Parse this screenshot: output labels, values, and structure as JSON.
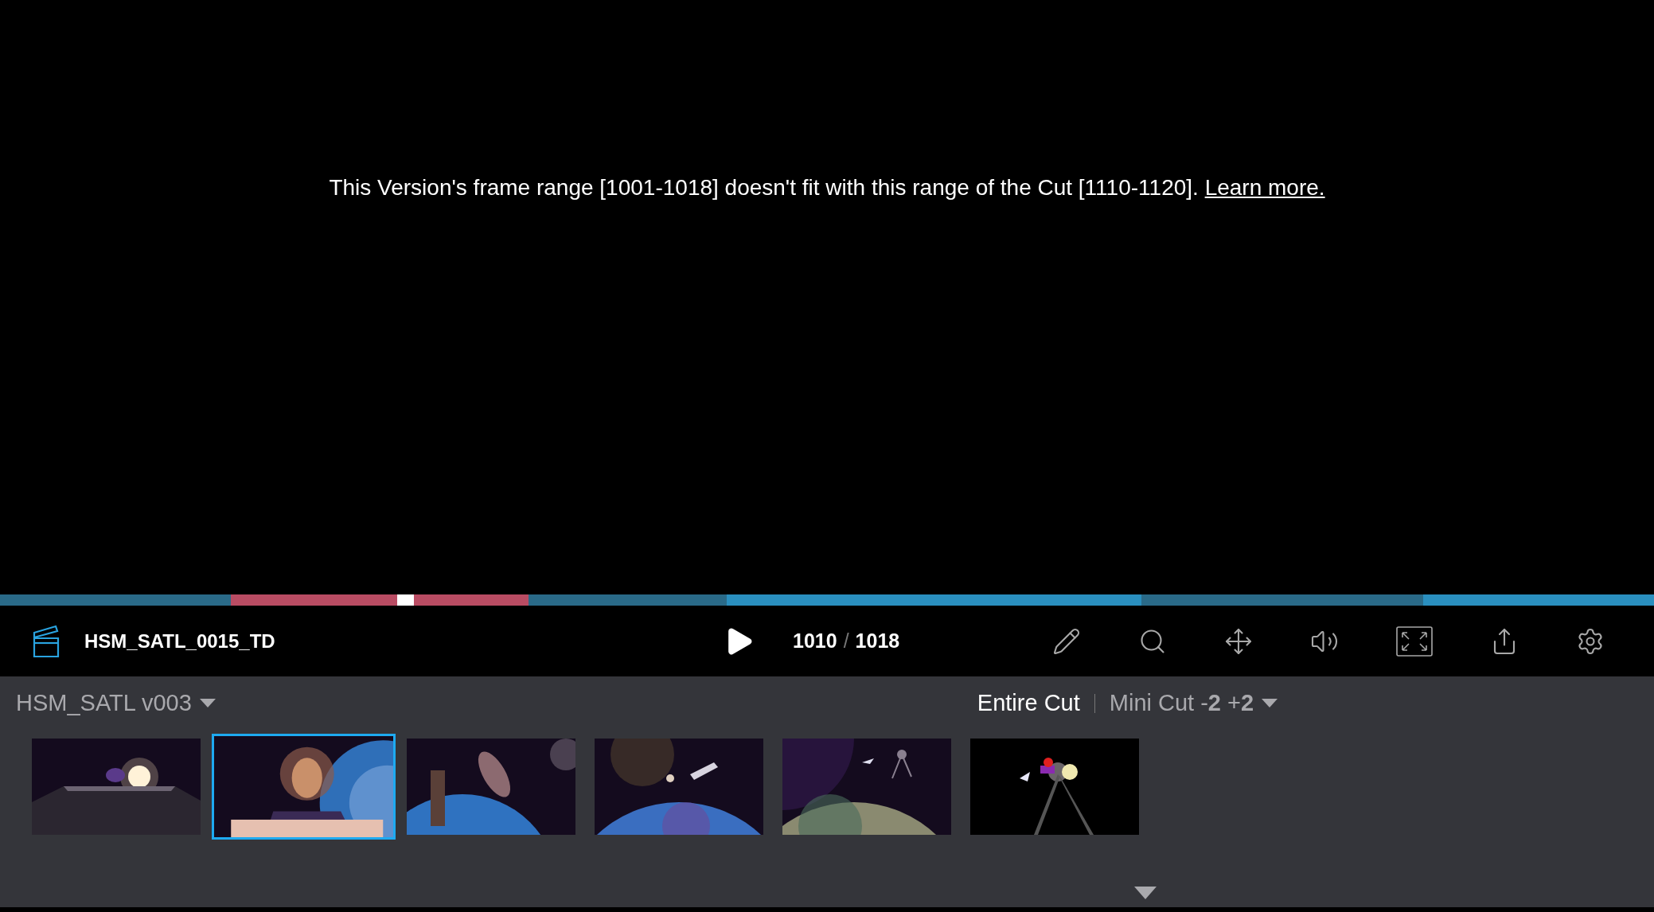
{
  "viewer": {
    "message": "This Version's frame range [1001-1018] doesn't fit with this range of the Cut [1110-1120].",
    "link": "Learn more."
  },
  "timeline": {
    "segments": [
      {
        "color": "#2a6a88"
      },
      {
        "color": "#b94c63"
      },
      {
        "color": "#b94c63"
      },
      {
        "color": "#2a6a88"
      },
      {
        "color": "#2a8fbf"
      },
      {
        "color": "#2a6a88"
      },
      {
        "color": "#2a8fbf"
      }
    ],
    "playhead": {
      "level": 0.24
    }
  },
  "toolbar": {
    "title": "HSM_SATL_0015_TD",
    "current_frame": "1010",
    "separator": "/",
    "total_frames": "1018"
  },
  "panel": {
    "version": "HSM_SATL v003",
    "views": [
      {
        "label": "Entire Cut",
        "selected": true
      },
      {
        "label": "Mini Cut -**2** +**2**",
        "selected": false
      }
    ],
    "thumbnails": [
      {
        "selected": false
      },
      {
        "selected": true
      },
      {
        "selected": false
      },
      {
        "selected": false
      },
      {
        "selected": false
      },
      {
        "selected": false
      }
    ]
  }
}
